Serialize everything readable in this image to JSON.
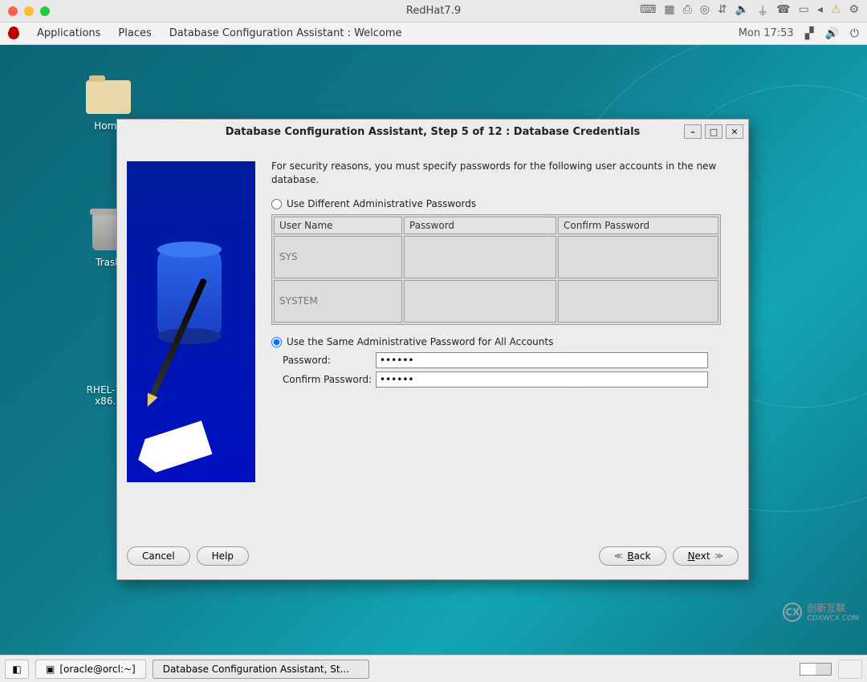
{
  "vm": {
    "title": "RedHat7.9"
  },
  "gnome": {
    "applications": "Applications",
    "places": "Places",
    "window_title": "Database Configuration Assistant : Welcome",
    "clock": "Mon 17:53"
  },
  "desktop_icons": {
    "home": "Home",
    "trash": "Trash",
    "iso": "RHEL-7.9 x86..."
  },
  "dialog": {
    "title": "Database Configuration Assistant, Step 5 of 12 : Database Credentials",
    "intro": "For security reasons, you must specify passwords for the following user accounts in the new database.",
    "radio_different": "Use Different Administrative Passwords",
    "radio_same": "Use the Same Administrative Password for All Accounts",
    "table": {
      "col_user": "User Name",
      "col_pwd": "Password",
      "col_confirm": "Confirm Password",
      "rows": [
        "SYS",
        "SYSTEM"
      ]
    },
    "field_password_label": "Password:",
    "field_confirm_label": "Confirm Password:",
    "password_value": "******",
    "confirm_value": "******",
    "btn_cancel": "Cancel",
    "btn_help": "Help",
    "btn_back": "Back",
    "btn_next": "Next"
  },
  "taskbar": {
    "terminal": "[oracle@orcl:~]",
    "dbca": "Database Configuration Assistant, St..."
  },
  "watermark": {
    "text": "创新互联",
    "sub": "CDXWCX.COM"
  }
}
